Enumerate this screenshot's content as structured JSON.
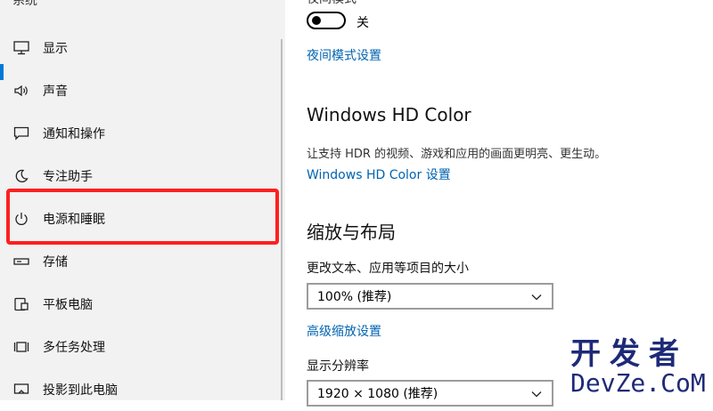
{
  "sidebar": {
    "header": "系统",
    "items": [
      {
        "label": "显示",
        "icon": "monitor-icon"
      },
      {
        "label": "声音",
        "icon": "speaker-icon"
      },
      {
        "label": "通知和操作",
        "icon": "message-icon"
      },
      {
        "label": "专注助手",
        "icon": "moon-icon"
      },
      {
        "label": "电源和睡眠",
        "icon": "power-icon"
      },
      {
        "label": "存储",
        "icon": "storage-icon"
      },
      {
        "label": "平板电脑",
        "icon": "tablet-icon"
      },
      {
        "label": "多任务处理",
        "icon": "multitask-icon"
      },
      {
        "label": "投影到此电脑",
        "icon": "project-icon"
      }
    ],
    "active_index": 0,
    "highlighted_index": 4
  },
  "main": {
    "night_light_title": "夜间模式",
    "night_light_state": "关",
    "night_light_settings_link": "夜间模式设置",
    "hd_color_title": "Windows HD Color",
    "hd_color_desc": "让支持 HDR 的视频、游戏和应用的画面更明亮、更生动。",
    "hd_color_link": "Windows HD Color 设置",
    "scale_title": "缩放与布局",
    "scale_label": "更改文本、应用等项目的大小",
    "scale_value": "100% (推荐)",
    "advanced_scale_link": "高级缩放设置",
    "resolution_label": "显示分辨率",
    "resolution_value": "1920 × 1080 (推荐)"
  },
  "watermark": {
    "line1": "开发者",
    "line2": "DevZe.CoM"
  },
  "colors": {
    "accent": "#0078d7",
    "link": "#0063b1",
    "highlight": "#ff1f1f",
    "watermark": "#1e2a78"
  }
}
